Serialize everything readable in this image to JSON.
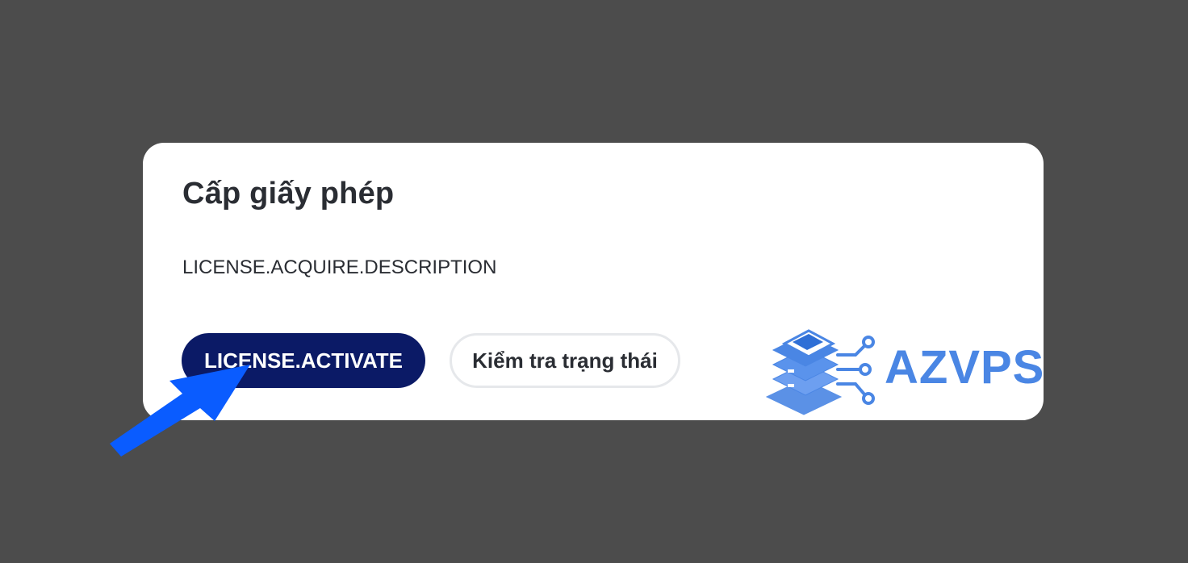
{
  "dialog": {
    "title": "Cấp giấy phép",
    "description": "LICENSE.ACQUIRE.DESCRIPTION",
    "activate_label": "LICENSE.ACTIVATE",
    "check_status_label": "Kiểm tra trạng thái"
  },
  "watermark": {
    "text": "AZVPS",
    "icon": "server-stack-icon",
    "color": "#4a86e4"
  },
  "annotation": {
    "icon": "pointer-arrow-icon",
    "color": "#0a5cff"
  },
  "colors": {
    "background": "#4c4c4c",
    "card": "#ffffff",
    "primary_button": "#0b1a66",
    "text": "#2a2d33"
  }
}
